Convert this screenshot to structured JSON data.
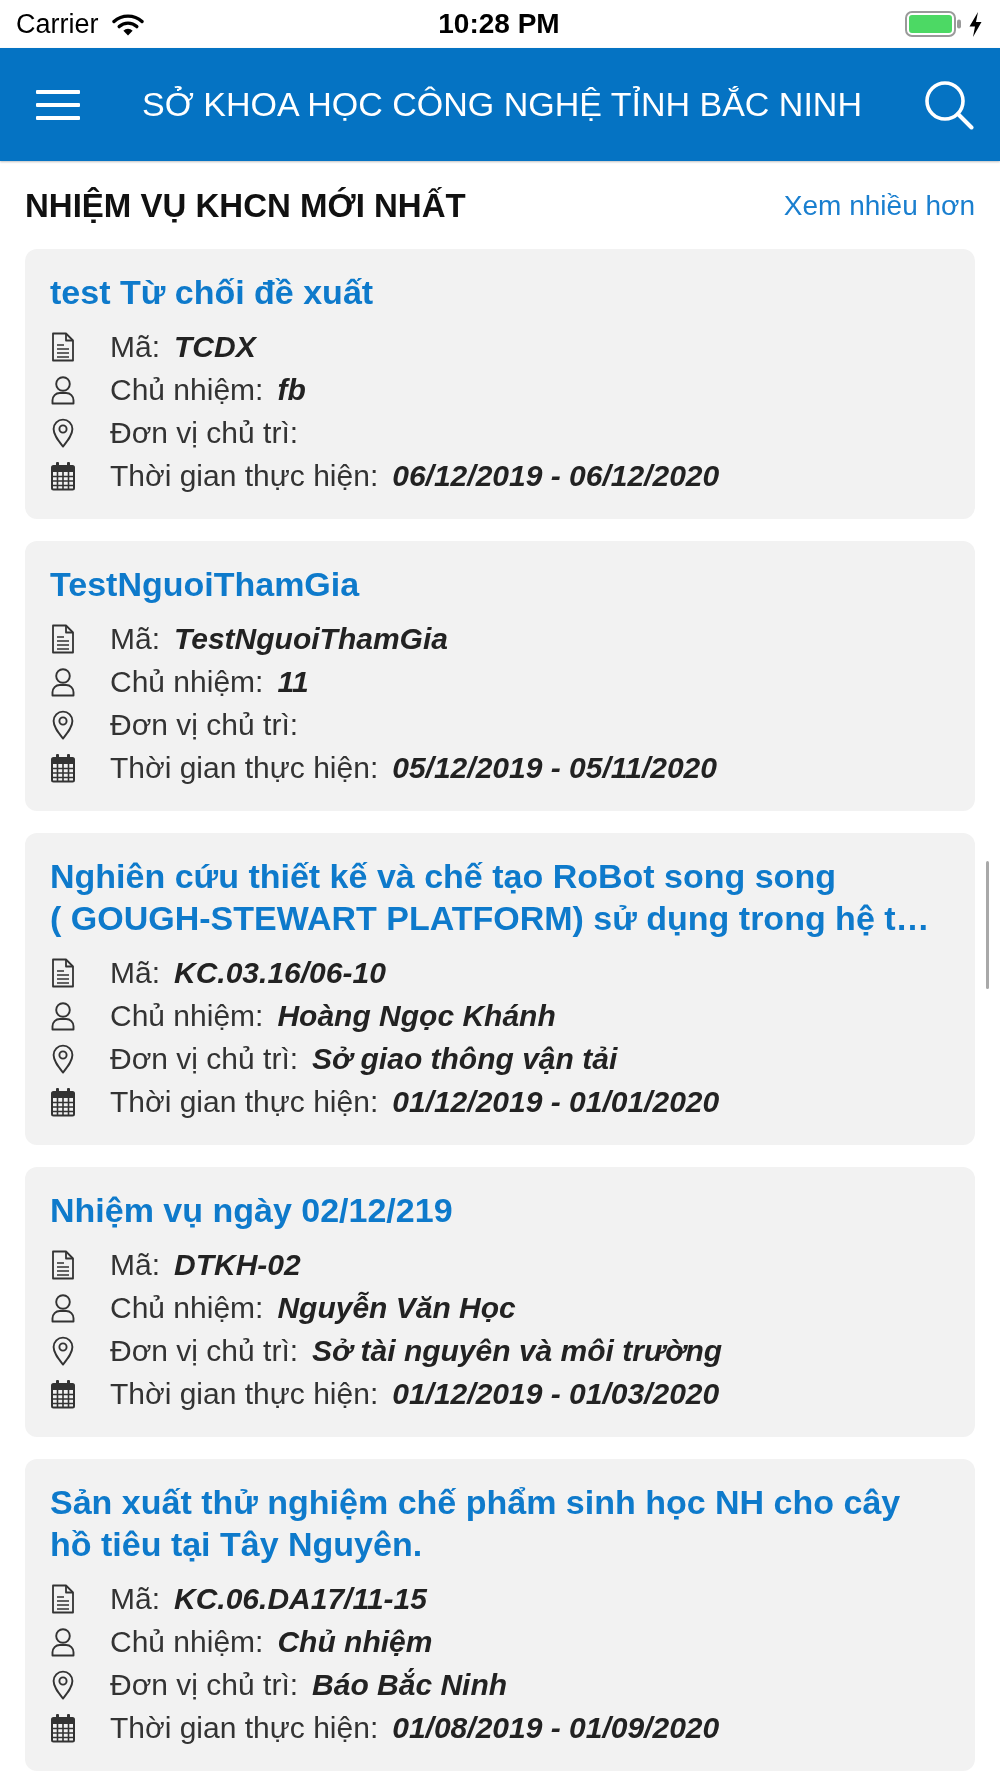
{
  "status_bar": {
    "carrier": "Carrier",
    "time": "10:28 PM"
  },
  "header": {
    "title": "SỞ KHOA HỌC CÔNG NGHỆ TỈNH BẮC NINH"
  },
  "section": {
    "title": "NHIỆM VỤ KHCN MỚI NHẤT",
    "more_link": "Xem nhiều hơn"
  },
  "tasks": [
    {
      "title": "test Từ chối đề xuất",
      "fields": [
        {
          "kind": "code",
          "label": "Mã:",
          "value": "TCDX"
        },
        {
          "kind": "manager",
          "label": "Chủ nhiệm:",
          "value": "fb"
        },
        {
          "kind": "unit",
          "label": "Đơn vị chủ trì:"
        },
        {
          "kind": "period",
          "label": "Thời gian thực hiện:",
          "value": "06/12/2019 - 06/12/2020"
        }
      ]
    },
    {
      "title": "TestNguoiThamGia",
      "fields": [
        {
          "kind": "code",
          "label": "Mã:",
          "value": "TestNguoiThamGia"
        },
        {
          "kind": "manager",
          "label": "Chủ nhiệm:",
          "value": "11"
        },
        {
          "kind": "unit",
          "label": "Đơn vị chủ trì:"
        },
        {
          "kind": "period",
          "label": "Thời gian thực hiện:",
          "value": "05/12/2019 - 05/11/2020"
        }
      ]
    },
    {
      "title": "Nghiên cứu thiết kế và chế tạo RoBot song song ( GOUGH-STEWART PLATFORM) sử dụng trong hệ t…",
      "fields": [
        {
          "kind": "code",
          "label": "Mã:",
          "value": "KC.03.16/06-10"
        },
        {
          "kind": "manager",
          "label": "Chủ nhiệm:",
          "value": "Hoàng Ngọc Khánh"
        },
        {
          "kind": "unit",
          "label": "Đơn vị chủ trì:",
          "value": "Sở giao thông vận tải"
        },
        {
          "kind": "period",
          "label": "Thời gian thực hiện:",
          "value": "01/12/2019 - 01/01/2020"
        }
      ]
    },
    {
      "title": "Nhiệm vụ ngày 02/12/219",
      "fields": [
        {
          "kind": "code",
          "label": "Mã:",
          "value": "DTKH-02"
        },
        {
          "kind": "manager",
          "label": "Chủ nhiệm:",
          "value": "Nguyễn Văn Học"
        },
        {
          "kind": "unit",
          "label": "Đơn vị chủ trì:",
          "value": "Sở tài nguyên và môi trường"
        },
        {
          "kind": "period",
          "label": "Thời gian thực hiện:",
          "value": "01/12/2019 - 01/03/2020"
        }
      ]
    },
    {
      "title": "Sản xuất thử nghiệm chế phẩm sinh học NH cho cây hồ tiêu tại Tây Nguyên.",
      "fields": [
        {
          "kind": "code",
          "label": "Mã:",
          "value": "KC.06.DA17/11-15"
        },
        {
          "kind": "manager",
          "label": "Chủ nhiệm:",
          "value": "Chủ nhiệm"
        },
        {
          "kind": "unit",
          "label": "Đơn vị chủ trì:",
          "value": "Báo Bắc Ninh"
        },
        {
          "kind": "period",
          "label": "Thời gian thực hiện:",
          "value": "01/08/2019 - 01/09/2020"
        }
      ]
    }
  ]
}
